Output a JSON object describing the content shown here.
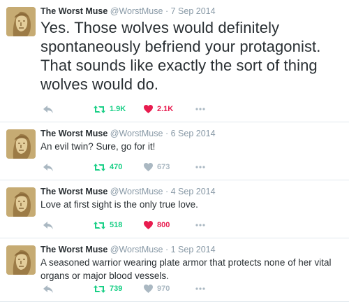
{
  "author": {
    "name": "The Worst Muse",
    "handle": "@WorstMuse",
    "separator": "·"
  },
  "tweets": [
    {
      "date": "7 Sep 2014",
      "text": "Yes. Those wolves would definitely spontaneously befriend your protagonist. That sounds like exactly the sort of thing wolves would do.",
      "retweets": "1.9K",
      "likes": "2.1K",
      "liked": true
    },
    {
      "date": "6 Sep 2014",
      "text": "An evil twin? Sure, go for it!",
      "retweets": "470",
      "likes": "673",
      "liked": false
    },
    {
      "date": "4 Sep 2014",
      "text": "Love at first sight is the only true love.",
      "retweets": "518",
      "likes": "800",
      "liked": true
    },
    {
      "date": "1 Sep 2014",
      "text": "A seasoned warrior wearing plate armor that protects none of her vital organs or major blood vessels.",
      "retweets": "739",
      "likes": "970",
      "liked": false
    }
  ],
  "icons": {
    "reply": "reply-icon",
    "retweet": "retweet-icon",
    "like": "heart-icon",
    "more": "more-icon"
  },
  "colors": {
    "retweet": "#19cf86",
    "liked": "#e81c4f",
    "muted": "#aab8c2",
    "text": "#292f33"
  }
}
